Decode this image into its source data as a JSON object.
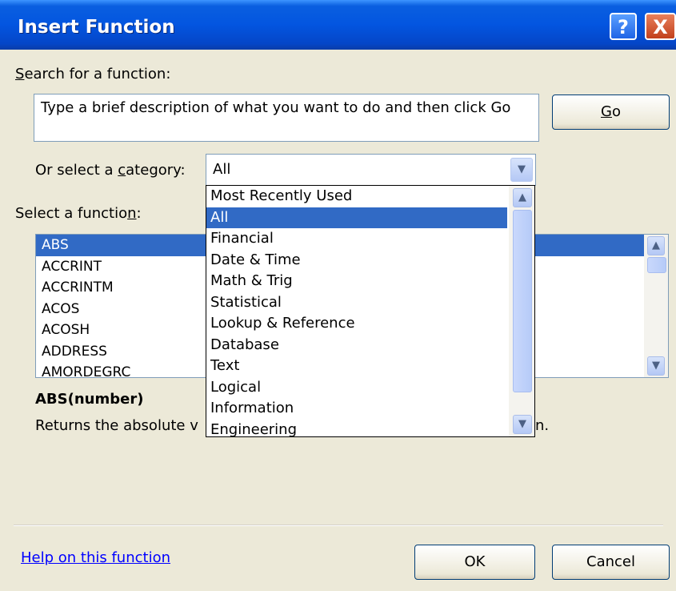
{
  "window": {
    "title": "Insert Function",
    "help_glyph": "?",
    "close_glyph": "X"
  },
  "search": {
    "label_prefix": "",
    "label_accel": "S",
    "label_rest": "earch for a function:",
    "value": "Type a brief description of what you want to do and then click Go",
    "go_accel": "G",
    "go_rest": "o"
  },
  "category": {
    "label_pre": "Or select a ",
    "label_accel": "c",
    "label_post": "ategory:",
    "selected": "All",
    "options": [
      "Most Recently Used",
      "All",
      "Financial",
      "Date & Time",
      "Math & Trig",
      "Statistical",
      "Lookup & Reference",
      "Database",
      "Text",
      "Logical",
      "Information",
      "Engineering"
    ],
    "selected_index": 1
  },
  "function_list": {
    "label_pre": "Select a functio",
    "label_accel": "n",
    "label_post": ":",
    "items": [
      "ABS",
      "ACCRINT",
      "ACCRINTM",
      "ACOS",
      "ACOSH",
      "ADDRESS",
      "AMORDEGRC"
    ],
    "selected_index": 0
  },
  "description": {
    "signature": "ABS(number)",
    "text_left": "Returns the absolute v",
    "text_right": "n."
  },
  "footer": {
    "help_link": "Help on this function",
    "ok_label": "OK",
    "cancel_label": "Cancel"
  },
  "icons": {
    "scroll_up": "chevron-up-icon",
    "scroll_down": "chevron-down-icon",
    "combo_arrow": "chevron-down-icon"
  },
  "colors": {
    "titlebar": "#0355e0",
    "selection": "#316ac5",
    "dialog_bg": "#ece9d8",
    "link": "#0000ff"
  }
}
